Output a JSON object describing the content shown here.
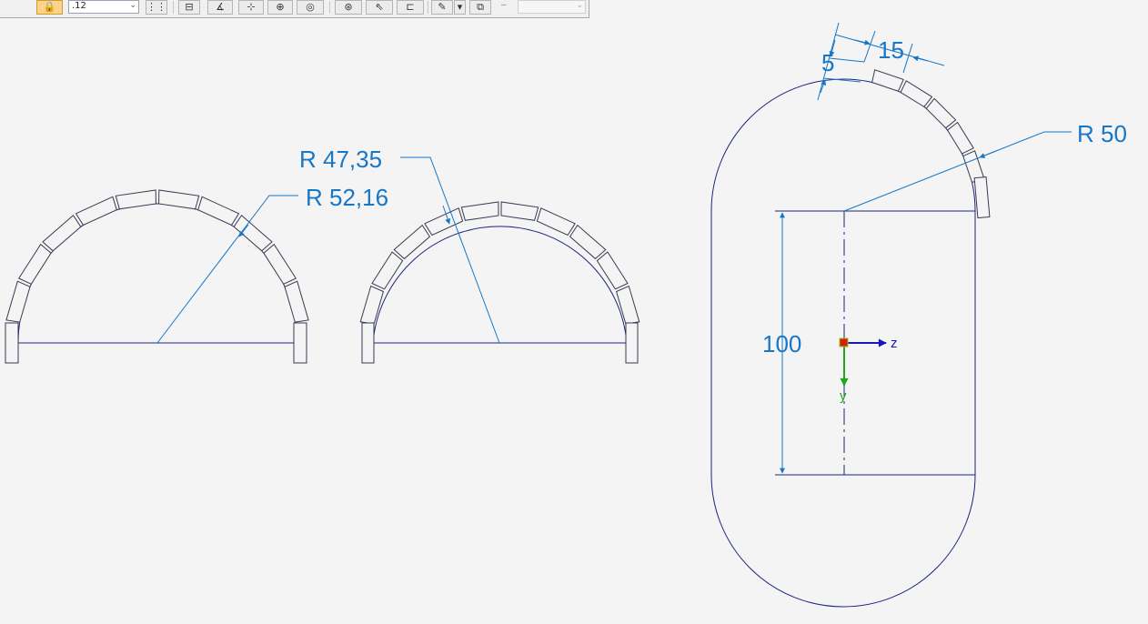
{
  "toolbar": {
    "scale_value": ".12",
    "linestyle_value": "",
    "separator_dash": "–",
    "buttons": [
      {
        "name": "lock-icon",
        "glyph": "🔒",
        "active": true
      },
      {
        "name": "grid-icon",
        "glyph": "⋮⋮",
        "active": false
      },
      {
        "name": "horizontal-dimension-icon",
        "glyph": "⊟",
        "active": false
      },
      {
        "name": "angle-dimension-icon",
        "glyph": "∡",
        "active": false
      },
      {
        "name": "point-icon",
        "glyph": "⊹",
        "active": false
      },
      {
        "name": "center-mark-icon",
        "glyph": "⊕",
        "active": false
      },
      {
        "name": "concentric-icon",
        "glyph": "◎",
        "active": false
      },
      {
        "name": "symmetry-icon",
        "glyph": "⊛",
        "active": false
      },
      {
        "name": "select-arrow-icon",
        "glyph": "⇖",
        "active": false
      },
      {
        "name": "attach-icon",
        "glyph": "⊏",
        "active": false
      },
      {
        "name": "edit-note-icon",
        "glyph": "✎",
        "active": false
      },
      {
        "name": "dropdown-arrow-icon",
        "glyph": "▾",
        "active": false
      },
      {
        "name": "copy-icon",
        "glyph": "⧉",
        "active": false
      }
    ]
  },
  "dimensions": {
    "radius_1": "R 52,16",
    "radius_2": "R 47,35",
    "radius_3": "R 50",
    "thickness": "5",
    "segment_length": "15",
    "height": "100"
  },
  "axis": {
    "z_label": "z",
    "y_label": "y"
  },
  "colors": {
    "geometry": "#1a237e",
    "dimension": "#1777c6",
    "axis_z": "#1818b8",
    "axis_y": "#22a322",
    "origin": "#d02010"
  }
}
